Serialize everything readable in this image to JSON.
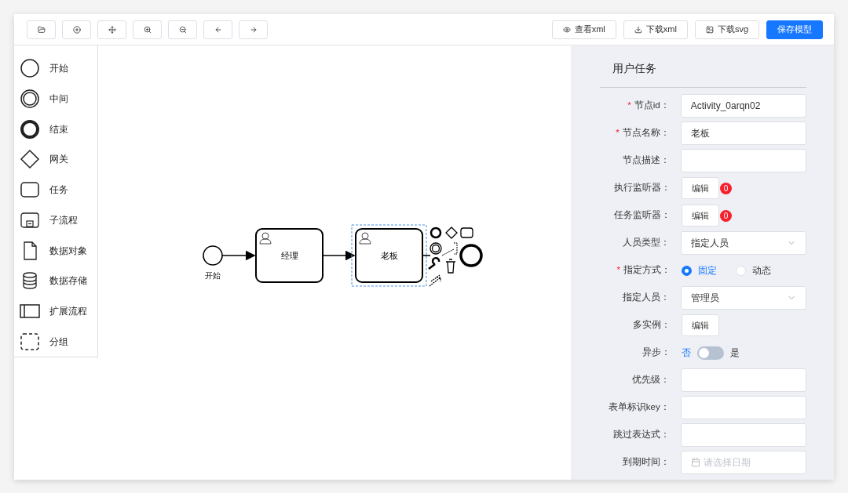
{
  "toolbar": {
    "actions": [
      {
        "label": "查看xml",
        "kind": "view",
        "primary": false
      },
      {
        "label": "下载xml",
        "kind": "download",
        "primary": false
      },
      {
        "label": "下载svg",
        "kind": "image",
        "primary": false
      },
      {
        "label": "保存模型",
        "kind": "save",
        "primary": true
      }
    ]
  },
  "palette": [
    {
      "label": "开始",
      "kind": "start"
    },
    {
      "label": "中间",
      "kind": "intermediate"
    },
    {
      "label": "结束",
      "kind": "end"
    },
    {
      "label": "网关",
      "kind": "gateway"
    },
    {
      "label": "任务",
      "kind": "task"
    },
    {
      "label": "子流程",
      "kind": "subprocess"
    },
    {
      "label": "数据对象",
      "kind": "data-object"
    },
    {
      "label": "数据存储",
      "kind": "data-store"
    },
    {
      "label": "扩展流程",
      "kind": "pool"
    },
    {
      "label": "分组",
      "kind": "group"
    }
  ],
  "diagram": {
    "nodes": [
      {
        "kind": "start-event",
        "label": "开始",
        "selected": false
      },
      {
        "kind": "user-task",
        "label": "经理",
        "selected": false
      },
      {
        "kind": "user-task",
        "label": "老板",
        "selected": true
      }
    ]
  },
  "panel": {
    "title": "用户任务",
    "fields": [
      {
        "kind": "input",
        "label": "节点id：",
        "required_mark": "*",
        "value": "Activity_0arqn02"
      },
      {
        "kind": "input",
        "label": "节点名称：",
        "required_mark": "*",
        "value": "老板"
      },
      {
        "kind": "input",
        "label": "节点描述："
      },
      {
        "kind": "button",
        "label": "执行监听器：",
        "button": "编辑",
        "badge": "0"
      },
      {
        "kind": "button",
        "label": "任务监听器：",
        "button": "编辑",
        "badge": "0"
      },
      {
        "kind": "select",
        "label": "人员类型：",
        "value": "指定人员"
      },
      {
        "kind": "radio",
        "label": "指定方式：",
        "required_mark": "*",
        "options": [
          {
            "label": "固定",
            "selected": true
          },
          {
            "label": "动态",
            "selected": false
          }
        ]
      },
      {
        "kind": "select",
        "label": "指定人员：",
        "value": "管理员"
      },
      {
        "kind": "button",
        "label": "多实例：",
        "button": "编辑"
      },
      {
        "kind": "switch",
        "label": "异步：",
        "off_label": "否",
        "on_label": "是",
        "on": false
      },
      {
        "kind": "input",
        "label": "优先级："
      },
      {
        "kind": "input",
        "label": "表单标识key："
      },
      {
        "kind": "input",
        "label": "跳过表达式："
      },
      {
        "kind": "date",
        "label": "到期时间：",
        "placeholder": "请选择日期"
      }
    ]
  }
}
